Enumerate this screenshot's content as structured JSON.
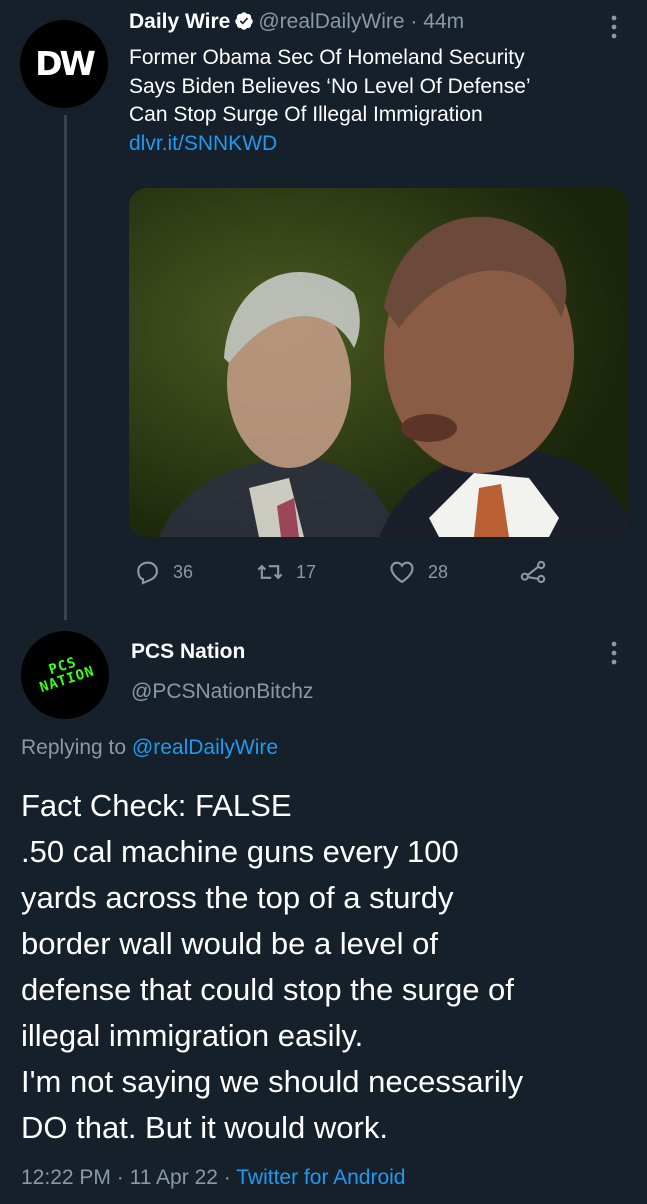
{
  "tweet1": {
    "avatar_text": "DW",
    "name": "Daily Wire",
    "handle": "@realDailyWire",
    "separator": "·",
    "time": "44m",
    "text_lines": [
      "Former Obama Sec Of Homeland Security",
      "Says Biden Believes ‘No Level Of Defense’",
      "Can Stop Surge Of Illegal Immigration"
    ],
    "link": "dlvr.it/SNNKWD",
    "replies": "36",
    "retweets": "17",
    "likes": "28"
  },
  "tweet2": {
    "avatar_text_line1": "PCS",
    "avatar_text_line2": "NATION",
    "name": "PCS Nation",
    "handle": "@PCSNationBitchz",
    "replying_prefix": "Replying to ",
    "replying_to": "@realDailyWire",
    "body_lines": [
      "Fact Check: FALSE",
      ".50 cal machine guns every 100",
      "yards across the top of a sturdy",
      "border wall would be a level of",
      "defense that could stop the surge of",
      "illegal immigration easily.",
      "I'm not saying we should necessarily",
      "DO that. But it would work."
    ],
    "time": "12:22 PM",
    "date": "11 Apr 22",
    "separator": "·",
    "client": "Twitter for Android"
  },
  "colors": {
    "background": "#15202b",
    "text": "#ffffff",
    "muted": "#8b98a5",
    "link": "#1d9bf0",
    "pcs_green": "#39ff14"
  },
  "icons": [
    "verified-badge-icon",
    "more-icon",
    "reply-icon",
    "retweet-icon",
    "like-icon",
    "share-icon"
  ]
}
